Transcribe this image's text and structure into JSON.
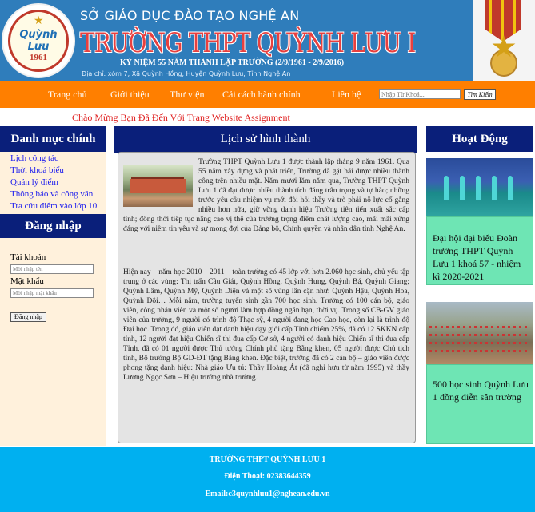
{
  "header": {
    "department": "SỞ GIÁO DỤC ĐÀO TẠO NGHỆ AN",
    "school_name": "TRƯỜNG THPT QUỲNH LƯU I",
    "anniversary": "KỶ NIỆM 55 NĂM THÀNH LẬP TRƯỜNG (2/9/1961 - 2/9/2016)",
    "address": "Địa chỉ: xóm 7, Xã Quỳnh Hồng,  Huyện Quỳnh Lưu, Tỉnh Nghệ An",
    "logo_text": "Quỳnh Lưu",
    "logo_year": "1961"
  },
  "nav": {
    "items": [
      "Trang chủ",
      "Giới thiệu",
      "Thư viện",
      "Cải cách hành chính",
      "Liên hệ"
    ],
    "search_placeholder": "Nhập Từ Khoá...",
    "search_button": "Tìm Kiếm"
  },
  "welcome": "Chào Mừng Bạn Đã Đến Với Trang Website Assignment",
  "menu": {
    "title": "Danh mục chính",
    "items": [
      "Lịch công tác",
      "Thời khoá biểu",
      "Quản lý điểm",
      "Thông báo và công văn",
      "Tra cứu điểm vào lớp 10"
    ]
  },
  "login": {
    "title": "Đăng nhập",
    "username_label": "Tài khoản",
    "username_placeholder": "Mời nhập tên",
    "password_label": "Mật khẩu",
    "password_placeholder": "Mời nhập mật khẩu",
    "button": "Đăng nhập"
  },
  "history": {
    "title": "Lịch sử hình thành",
    "paragraph1": "Trường THPT Quỳnh Lưu 1 được thành lập tháng 9 năm 1961. Qua 55 năm xây dựng và phát triển, Trường đã gặt hái được nhiều thành công trên nhiều mặt. Năm mươi lăm năm qua, Trường THPT Quỳnh Lưu 1 đã đạt được nhiều thành tích đáng trân trọng và tự hào; những trước yêu cầu nhiệm vụ mới đòi hỏi thầy và trò phải nỗ lực cố gắng nhiều hơn nữa, giữ vững danh hiệu Trường tiên tiến xuất sắc cấp tỉnh; đồng thời tiếp tục nâng cao vị thế của trường trọng điểm chất lượng cao, mãi mãi xứng đáng với niềm tin yêu và sự mong đợi của Đảng bộ, Chính quyền và nhân dân tỉnh Nghệ An.",
    "paragraph2": "Hiện nay – năm học 2010 – 2011 – toàn trường có 45 lớp với hơn 2.060 học sinh, chủ yếu tập trung ở các vùng: Thị trấn Cầu Giát, Quỳnh Hồng, Quỳnh Hưng, Quỳnh Bá, Quỳnh Giang; Quỳnh Lâm, Quỳnh Mỹ, Quỳnh Diện và một số vùng lân cận như: Quỳnh Hậu, Quỳnh Hoa, Quỳnh Đôi… Mỗi năm, trường tuyển sinh gần 700 học sinh. Trường có 100 cán bộ, giáo viên, công nhân viên và một số người làm hợp đồng ngắn hạn, thời vụ. Trong số CB-GV giáo viên của trường, 9 người có trình độ Thạc sỹ, 4 người đang học Cao học, còn lại là trình độ Đại học. Trong đó, giáo viên đạt danh hiệu dạy giỏi cấp Tỉnh chiếm 25%, đã có 12 SKKN cấp tỉnh, 12 người đạt hiệu Chiến sĩ thi đua cấp Cơ sở, 4 người có danh hiệu Chiến sĩ thi đua cấp Tỉnh, đã có 01 người được Thủ tướng Chính phủ tặng Bằng khen, 05 người được Chủ tịch tỉnh, Bộ trưởng Bộ GD-ĐT tặng Bằng khen. Đặc biệt, trường đã có 2 cán bộ – giáo viên được phong tặng danh hiệu: Nhà giáo Ưu tú: Thầy Hoàng Át (đã nghỉ hưu từ năm 1995) và thầy Lương Ngọc Sơn – Hiệu trưởng nhà trường."
  },
  "activities": {
    "title": "Hoạt Động",
    "items": [
      "Đại hội đại biểu Đoàn trường THPT Quỳnh Lưu 1 khoá 57 - nhiệm kì 2020-2021",
      "500 học sinh Quỳnh Lưu 1 đồng diễn sân trường"
    ]
  },
  "footer": {
    "school": "TRƯỜNG THPT QUỲNH LƯU 1",
    "phone_label": "Điện Thoại:",
    "phone": "02383644359",
    "email_label": "Email:",
    "email": "c3quynhluu1@nghean.edu.vn"
  }
}
